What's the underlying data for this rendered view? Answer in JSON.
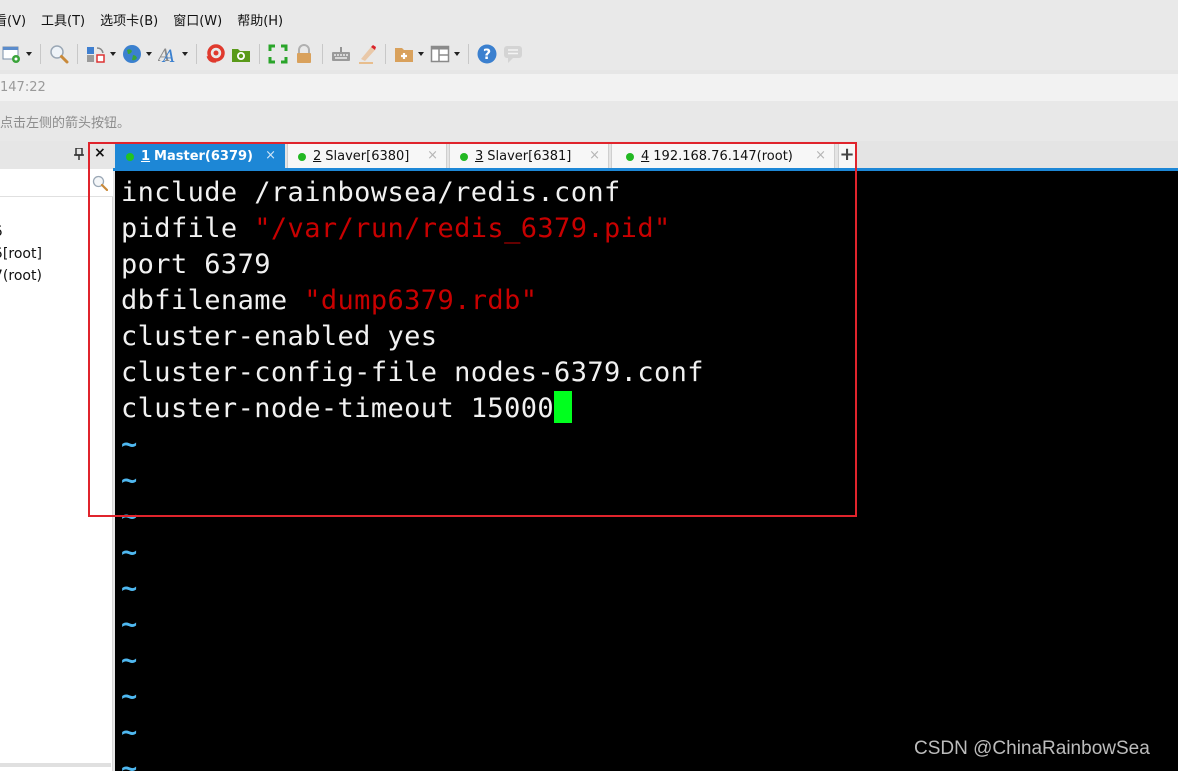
{
  "menu": {
    "items": [
      "看(V)",
      "工具(T)",
      "选项卡(B)",
      "窗口(W)",
      "帮助(H)"
    ]
  },
  "toolbar": {
    "buttons": [
      {
        "name": "session-settings-icon",
        "has_dropdown": true
      },
      {
        "name": "find-icon",
        "has_dropdown": false
      },
      {
        "name": "transfer-icon",
        "has_dropdown": true
      },
      {
        "name": "globe-icon",
        "has_dropdown": true
      },
      {
        "name": "font-icon",
        "has_dropdown": true
      },
      {
        "name": "xshell-swirl-icon",
        "has_dropdown": false
      },
      {
        "name": "xftp-icon",
        "has_dropdown": false
      },
      {
        "name": "fullscreen-icon",
        "has_dropdown": false
      },
      {
        "name": "lock-icon",
        "has_dropdown": false
      },
      {
        "name": "keyboard-icon",
        "has_dropdown": false
      },
      {
        "name": "highlight-pen-icon",
        "has_dropdown": false
      },
      {
        "name": "new-folder-icon",
        "has_dropdown": true
      },
      {
        "name": "layout-icon",
        "has_dropdown": true
      },
      {
        "name": "help-icon",
        "has_dropdown": false
      },
      {
        "name": "chat-icon",
        "has_dropdown": false
      }
    ]
  },
  "address_bar": {
    "value": "147:22"
  },
  "hint_bar": {
    "text": "点击左侧的箭头按钮。"
  },
  "session_panel": {
    "items": [
      "5",
      "5[root]",
      "7(root)"
    ]
  },
  "tabs": [
    {
      "number": "1",
      "label": "Master(6379)",
      "active": true,
      "status": "connected"
    },
    {
      "number": "2",
      "label": "Slaver[6380]",
      "active": false,
      "status": "connected"
    },
    {
      "number": "3",
      "label": "Slaver[6381]",
      "active": false,
      "status": "connected"
    },
    {
      "number": "4",
      "label": "192.168.76.147(root)",
      "active": false,
      "status": "connected"
    }
  ],
  "tab_close_glyph": "×",
  "add_tab_glyph": "+",
  "panel_close_glyph": "×",
  "terminal": {
    "lines": [
      {
        "key": "include",
        "value": " /rainbowsea/redis.conf",
        "quoted": false
      },
      {
        "key": "pidfile",
        "value": "\"/var/run/redis_6379.pid\"",
        "quoted": true
      },
      {
        "key": "port",
        "value": " 6379",
        "quoted": false
      },
      {
        "key": "dbfilename",
        "value": "\"dump6379.rdb\"",
        "quoted": true
      },
      {
        "key": "cluster-enabled",
        "value": " yes",
        "quoted": false
      },
      {
        "key": "cluster-config-file",
        "value": " nodes-6379.conf",
        "quoted": false
      },
      {
        "key": "cluster-node-timeout",
        "value": " 15000",
        "quoted": false
      }
    ],
    "tilde_lines": 10,
    "tilde_glyph": "~",
    "cursor_color": "#00ff1e",
    "string_color": "#c80000",
    "tilde_color": "#4fb8f0"
  },
  "watermark": "CSDN @ChinaRainbowSea",
  "colors": {
    "accent": "#1d87d6",
    "status_dot": "#22b822",
    "highlight_box": "#e0242c"
  }
}
